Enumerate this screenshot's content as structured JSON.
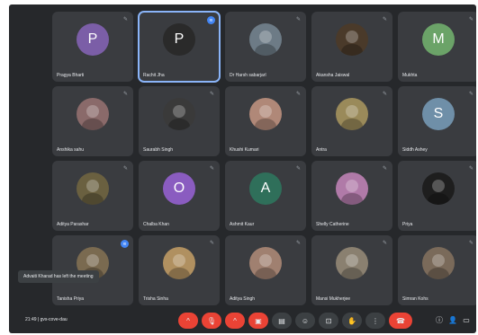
{
  "meeting": {
    "time": "21:49",
    "separator": "|",
    "code": "gvs-cove-dau",
    "toast": "Advaiti Kharad has left the meeting"
  },
  "participants": [
    {
      "name": "Pragya Bharti",
      "initial": "P",
      "avatar_color": "#7b5ea7",
      "type": "letter",
      "mic": "muted"
    },
    {
      "name": "Rachit Jha",
      "initial": "P",
      "avatar_color": "#2a2a2a",
      "type": "letter",
      "active": true,
      "speaking": true
    },
    {
      "name": "Dr Harsh sabarjarl",
      "initial": "",
      "avatar_color": "#6d7b86",
      "type": "photo",
      "mic": "muted"
    },
    {
      "name": "Akansha Jaiswal",
      "initial": "",
      "avatar_color": "#4a3a2a",
      "type": "photo",
      "mic": "muted"
    },
    {
      "name": "Mukhta",
      "initial": "M",
      "avatar_color": "#6ba368",
      "type": "letter",
      "mic": "muted"
    },
    {
      "name": "Anshika sahu",
      "initial": "",
      "avatar_color": "#8a6a6a",
      "type": "photo",
      "mic": "muted"
    },
    {
      "name": "Saurabh Singh",
      "initial": "",
      "avatar_color": "#3a3a3a",
      "type": "photo",
      "mic": "muted"
    },
    {
      "name": "Khushi Kumari",
      "initial": "",
      "avatar_color": "#b08878",
      "type": "photo",
      "mic": "muted"
    },
    {
      "name": "Antra",
      "initial": "",
      "avatar_color": "#9a8a5a",
      "type": "photo",
      "mic": "muted"
    },
    {
      "name": "Siddh Ashey",
      "initial": "S",
      "avatar_color": "#6f8fa8",
      "type": "letter",
      "mic": "muted"
    },
    {
      "name": "Aditya Parashar",
      "initial": "",
      "avatar_color": "#6a6040",
      "type": "photo",
      "mic": "muted"
    },
    {
      "name": "Chalba Khan",
      "initial": "O",
      "avatar_color": "#8a5cc0",
      "type": "letter",
      "mic": "muted"
    },
    {
      "name": "Ashmit Kaur",
      "initial": "A",
      "avatar_color": "#2f6f5a",
      "type": "letter",
      "mic": "muted"
    },
    {
      "name": "Shelly Catherine",
      "initial": "",
      "avatar_color": "#b07aa8",
      "type": "photo",
      "mic": "muted"
    },
    {
      "name": "Priya",
      "initial": "",
      "avatar_color": "#1e1e1e",
      "type": "photo",
      "mic": "muted"
    },
    {
      "name": "Tanisha Priya",
      "initial": "",
      "avatar_color": "#7a6a50",
      "type": "photo",
      "speaking": true
    },
    {
      "name": "Trisha Sinha",
      "initial": "",
      "avatar_color": "#b09060",
      "type": "photo",
      "mic": "muted"
    },
    {
      "name": "Aditya Singh",
      "initial": "",
      "avatar_color": "#a08070",
      "type": "photo",
      "mic": "muted"
    },
    {
      "name": "Mansi Mukherjee",
      "initial": "",
      "avatar_color": "#8a8070",
      "type": "photo",
      "mic": "muted"
    },
    {
      "name": "Simran Kohs",
      "initial": "",
      "avatar_color": "#7a6a5a",
      "type": "photo",
      "mic": "muted"
    }
  ],
  "controls": {
    "mic_icon": "mic-off-icon",
    "camera_icon": "camera-off-icon",
    "captions_icon": "captions-icon",
    "emoji_icon": "emoji-icon",
    "present_icon": "present-icon",
    "hand_icon": "raise-hand-icon",
    "more_icon": "more-options-icon",
    "hangup_icon": "hangup-icon",
    "glyphs": {
      "chevron": "^",
      "mic": "🎙",
      "camera": "▣",
      "captions": "▤",
      "emoji": "☺",
      "present": "⊡",
      "hand": "✋",
      "more": "⋮",
      "hangup": "☎",
      "info": "ⓘ",
      "people": "👤",
      "chat": "▭",
      "mic_small": "✎",
      "speak": "≋"
    }
  }
}
